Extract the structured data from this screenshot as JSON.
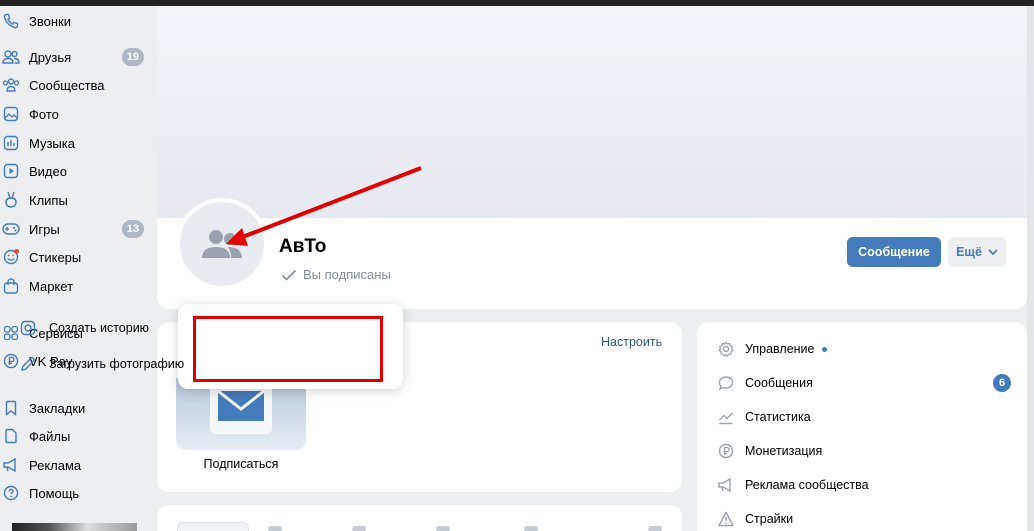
{
  "sidebar": {
    "items": [
      {
        "label": "Звонки",
        "icon": "phone-icon"
      },
      {
        "label": "Друзья",
        "icon": "friends-icon",
        "badge": "19"
      },
      {
        "label": "Сообщества",
        "icon": "communities-icon"
      },
      {
        "label": "Фото",
        "icon": "photo-icon"
      },
      {
        "label": "Музыка",
        "icon": "music-icon"
      },
      {
        "label": "Видео",
        "icon": "video-icon"
      },
      {
        "label": "Клипы",
        "icon": "clips-icon"
      },
      {
        "label": "Игры",
        "icon": "games-icon",
        "badge": "13"
      },
      {
        "label": "Стикеры",
        "icon": "stickers-icon"
      },
      {
        "label": "Маркет",
        "icon": "market-icon"
      },
      {
        "label": "Сервисы",
        "icon": "services-icon"
      },
      {
        "label": "VK Pay",
        "icon": "vkpay-icon"
      },
      {
        "label": "Закладки",
        "icon": "bookmarks-icon"
      },
      {
        "label": "Файлы",
        "icon": "files-icon"
      },
      {
        "label": "Реклама",
        "icon": "ads-icon"
      },
      {
        "label": "Помощь",
        "icon": "help-icon"
      }
    ]
  },
  "group": {
    "name": "АвТо",
    "subscription_status": "Вы подписаны"
  },
  "header": {
    "message_button": "Сообщение",
    "more_button": "Ещё"
  },
  "avatar_menu": {
    "items": [
      {
        "label": "Создать историю",
        "icon": "story-icon"
      },
      {
        "label": "Загрузить фотографию",
        "icon": "pencil-icon"
      }
    ]
  },
  "main": {
    "customize_link": "Настроить",
    "subscribe_label": "Подписаться"
  },
  "management": {
    "items": [
      {
        "label": "Управление",
        "icon": "gear-icon",
        "dot": true
      },
      {
        "label": "Сообщения",
        "icon": "chat-icon",
        "count": "6"
      },
      {
        "label": "Статистика",
        "icon": "stats-icon"
      },
      {
        "label": "Монетизация",
        "icon": "ruble-icon"
      },
      {
        "label": "Реклама сообщества",
        "icon": "megaphone-icon"
      },
      {
        "label": "Страйки",
        "icon": "warning-icon"
      }
    ]
  },
  "colors": {
    "accent": "#447bba",
    "annotation": "#e00000",
    "badge": "#aeb7c2"
  }
}
